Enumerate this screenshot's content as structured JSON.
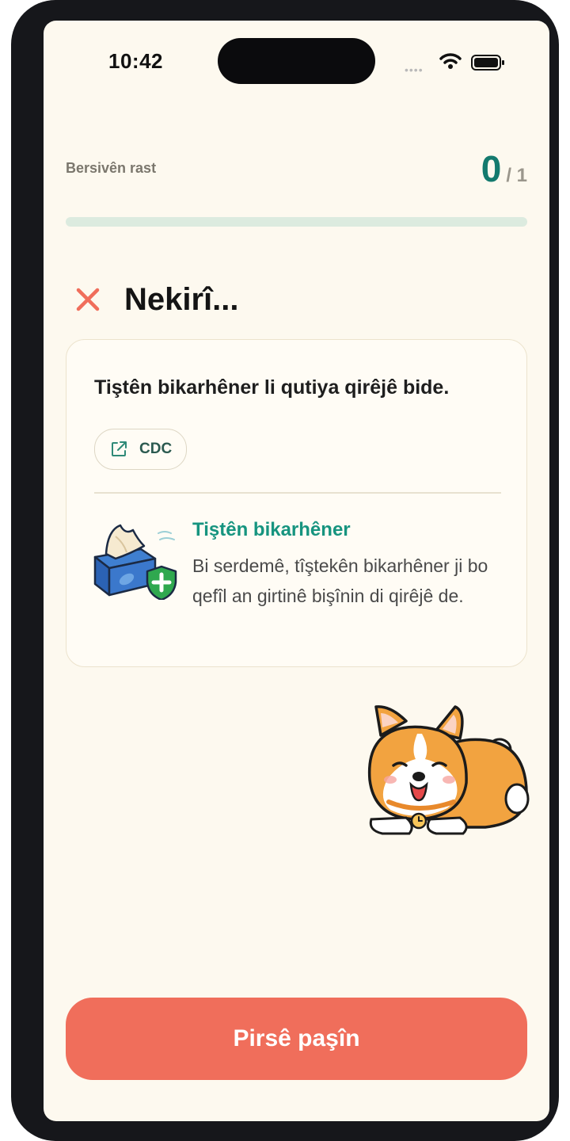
{
  "status_bar": {
    "time": "10:42"
  },
  "score": {
    "label": "Bersivên rast",
    "correct": "0",
    "total": "/ 1",
    "progress": 0
  },
  "result": {
    "text": "Nekirî..."
  },
  "card": {
    "question": "Tiştên bikarhêner li qutiya qirêjê bide.",
    "source": {
      "label": "CDC",
      "icon": "external-link-icon"
    },
    "fact": {
      "title": "Tiştên bikarhêner",
      "body": "Bi serdemê, tîştekên bikarhêner ji bo qefîl an girtinê bişînin di qirêjê de."
    }
  },
  "colors": {
    "accent": "#137a6e",
    "button": "#f06e5b",
    "incorrect": "#f06e5b",
    "background": "#fdf9ef"
  },
  "footer": {
    "next_button": "Pirsê paşîn"
  }
}
